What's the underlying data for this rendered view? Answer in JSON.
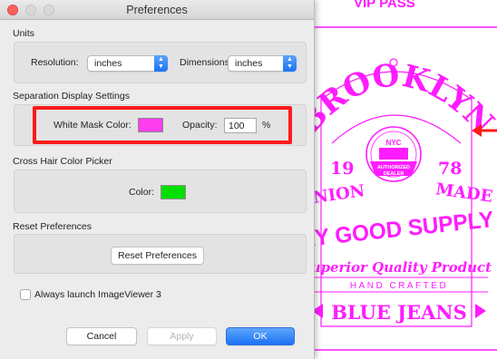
{
  "window": {
    "title": "Preferences"
  },
  "units": {
    "section_title": "Units",
    "resolution_label": "Resolution:",
    "resolution_value": "inches",
    "dimensions_label": "Dimensions:",
    "dimensions_value": "inches"
  },
  "separation": {
    "section_title": "Separation Display Settings",
    "white_mask_label": "White Mask Color:",
    "white_mask_color": "#ff3cf0",
    "opacity_label": "Opacity:",
    "opacity_value": "100",
    "opacity_unit": "%"
  },
  "crosshair": {
    "section_title": "Cross Hair Color Picker",
    "color_label": "Color:",
    "color_value": "#00e000"
  },
  "reset": {
    "section_title": "Reset Preferences",
    "button_label": "Reset Preferences"
  },
  "launch": {
    "checkbox_label": "Always launch ImageViewer 3",
    "checked": false
  },
  "buttons": {
    "cancel": "Cancel",
    "apply": "Apply",
    "ok": "OK"
  },
  "artwork": {
    "header_text": "VIP PASS",
    "brand": "BROOKLYN",
    "badge_top": "NYC",
    "badge_bottom_1": "AUTHORIZED",
    "badge_bottom_2": "DEALER",
    "year_left": "19",
    "year_right": "78",
    "union": "UNION",
    "made": "MADE",
    "supply": "RY GOOD SUPPLY",
    "quality": "Superior Quality Product",
    "hand_crafted": "HAND CRAFTED",
    "blue_jeans": "BLUE JEANS"
  },
  "colors": {
    "accent_blue": "#1b72f5",
    "highlight_red": "#ff1a1a",
    "artwork_magenta": "#ff1cff"
  }
}
